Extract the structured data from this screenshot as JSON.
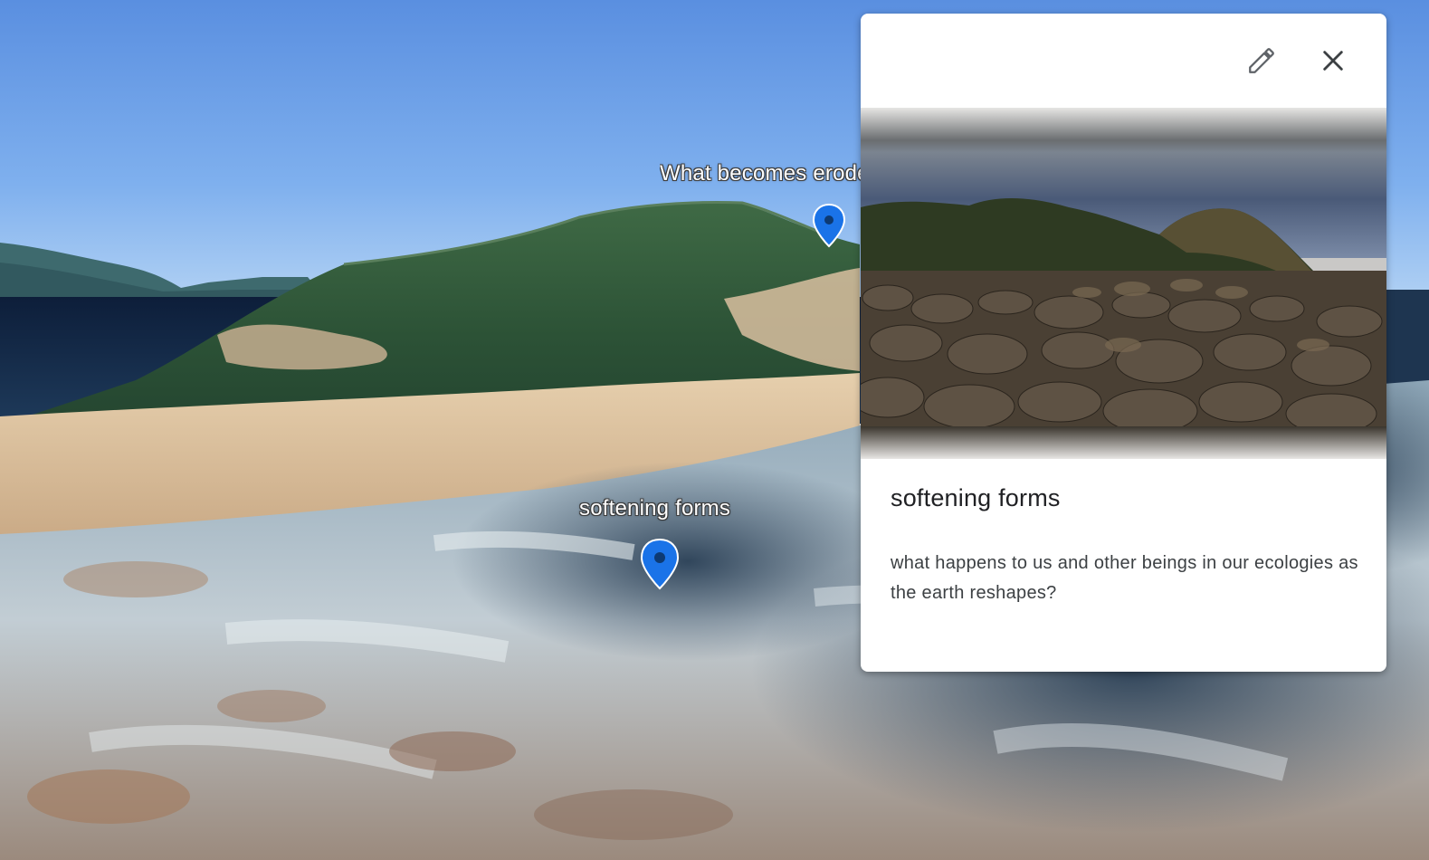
{
  "map": {
    "placemarks": [
      {
        "label": "What becomes eroded",
        "icon": "map-pin-icon",
        "color": "#1a73e8"
      },
      {
        "label": "softening forms",
        "icon": "map-pin-icon",
        "color": "#1a73e8"
      }
    ]
  },
  "info_card": {
    "title": "softening forms",
    "description": "what happens to us and other beings in our ecologies as the earth reshapes?",
    "photo": "rocky-coastline-photo",
    "edit_icon": "pencil-icon",
    "close_icon": "close-icon"
  },
  "colors": {
    "pin": "#1a73e8",
    "pin_center": "#0d3a73",
    "sky": "#6fa2e6",
    "card_bg": "#ffffff",
    "title_text": "#202124",
    "body_text": "#3c4043",
    "icon": "#5f6368"
  }
}
